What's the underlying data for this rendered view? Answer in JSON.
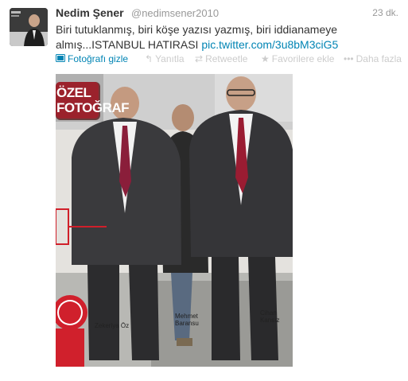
{
  "tweet": {
    "fullname": "Nedim Şener",
    "username": "@nedimsener2010",
    "timestamp": "23 dk.",
    "text_line1": "Biri tutuklanmış, biri köşe yazısı yazmış, biri iddianameye",
    "text_line2": "almış...ISTANBUL HATIRASI ",
    "link": "pic.twitter.com/3u8bM3ciG5"
  },
  "actions": {
    "photo_toggle": "Fotoğrafı gizle",
    "reply": "Yanıtla",
    "retweet": "Retweetle",
    "favorite": "Favorilere ekle",
    "more": "Daha fazla"
  },
  "media": {
    "sign_line1": "ÖZEL",
    "sign_line2": "FOTOĞRAF",
    "caption_left": "Zekeriya Öz",
    "caption_middle": "Mehmet Baransu",
    "caption_right": "Cihan Kansız"
  },
  "colors": {
    "link": "#0084b4",
    "muted": "#999999",
    "disabled_action": "#cccccc",
    "text": "#333333"
  },
  "icons": {
    "photo": "photo-icon",
    "reply": "reply-icon",
    "retweet": "retweet-icon",
    "favorite": "star-icon",
    "more": "dots-icon"
  }
}
